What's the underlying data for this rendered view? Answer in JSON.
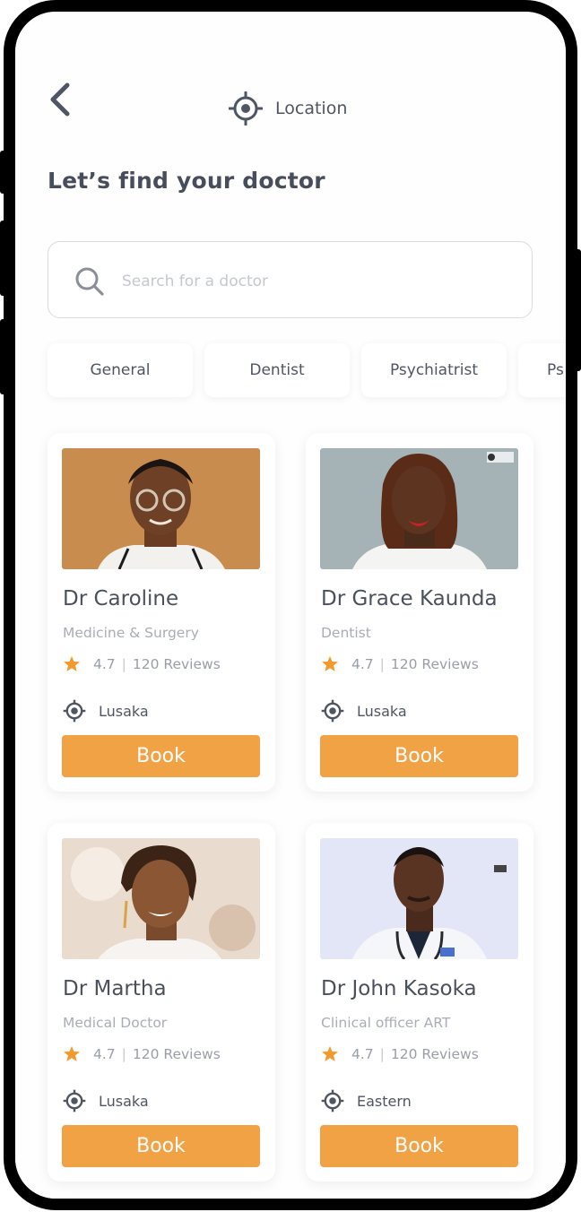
{
  "header": {
    "location_label": "Location",
    "back_icon": "chevron-left-icon",
    "location_icon": "crosshair-location-icon"
  },
  "page_title": "Let’s find your doctor",
  "search": {
    "placeholder": "Search for a doctor",
    "icon": "search-icon"
  },
  "categories": [
    "General",
    "Dentist",
    "Psychiatrist",
    "Ps"
  ],
  "doctors": [
    {
      "name": "Dr Caroline",
      "specialty": "Medicine & Surgery",
      "rating": "4.7",
      "reviews": "120 Reviews",
      "location": "Lusaka",
      "book_label": "Book"
    },
    {
      "name": "Dr Grace Kaunda",
      "specialty": "Dentist",
      "rating": "4.7",
      "reviews": "120 Reviews",
      "location": "Lusaka",
      "book_label": "Book"
    },
    {
      "name": "Dr Martha",
      "specialty": "Medical Doctor",
      "rating": "4.7",
      "reviews": "120 Reviews",
      "location": "Lusaka",
      "book_label": "Book"
    },
    {
      "name": "Dr John Kasoka",
      "specialty": "Clinical officer ART",
      "rating": "4.7",
      "reviews": "120 Reviews",
      "location": "Eastern",
      "book_label": "Book"
    }
  ],
  "colors": {
    "accent": "#f0a244",
    "star": "#f39a2c",
    "text_dark": "#474d5a",
    "text_muted": "#a9adb5"
  }
}
